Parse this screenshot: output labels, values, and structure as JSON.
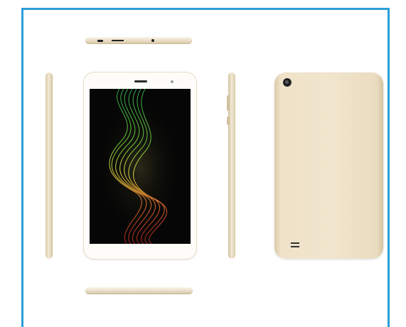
{
  "colors": {
    "frame": "#2a9fd8",
    "body_gold": "#efe2c9",
    "screen_bezel": "#fdfcf9",
    "screen_background": "#060606"
  },
  "views": [
    {
      "name": "top-edge"
    },
    {
      "name": "left-side"
    },
    {
      "name": "front"
    },
    {
      "name": "right-side"
    },
    {
      "name": "back"
    },
    {
      "name": "bottom-edge"
    }
  ],
  "icons": {
    "rear_camera": "camera-icon",
    "front_camera": "camera-icon",
    "speaker": "speaker-grille-icon"
  }
}
